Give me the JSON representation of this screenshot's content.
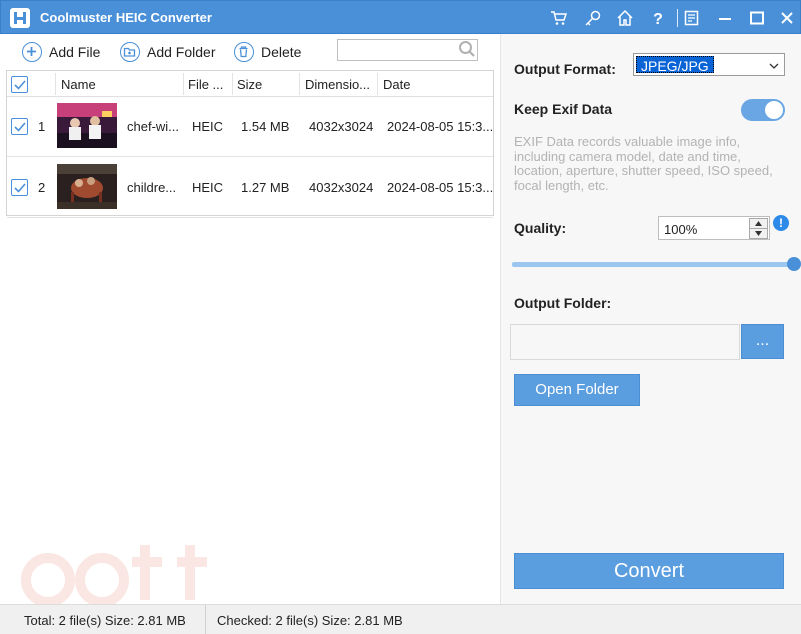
{
  "app": {
    "title": "Coolmuster HEIC Converter"
  },
  "titlebar_icons": [
    "cart-icon",
    "key-icon",
    "home-icon",
    "help-icon",
    "feedback-icon",
    "minimize-icon",
    "maximize-icon",
    "close-icon"
  ],
  "toolbar": {
    "add_file": "Add File",
    "add_folder": "Add Folder",
    "delete": "Delete",
    "search_value": ""
  },
  "table": {
    "headers": [
      "Name",
      "File ...",
      "Size",
      "Dimensio...",
      "Date"
    ],
    "rows": [
      {
        "index": "1",
        "name": "chef-wi...",
        "type": "HEIC",
        "size": "1.54 MB",
        "dimension": "4032x3024",
        "date": "2024-08-05 15:3...",
        "checked": true
      },
      {
        "index": "2",
        "name": "childre...",
        "type": "HEIC",
        "size": "1.27 MB",
        "dimension": "4032x3024",
        "date": "2024-08-05 15:3...",
        "checked": true
      }
    ]
  },
  "settings": {
    "output_format_label": "Output Format:",
    "output_format_value": "JPEG/JPG",
    "keep_exif_label": "Keep Exif Data",
    "keep_exif_on": true,
    "exif_description": "EXIF Data records valuable image info, including camera model, date and time, location, aperture, shutter speed, ISO speed, focal length, etc.",
    "quality_label": "Quality:",
    "quality_value": "100%",
    "quality_level": 1.0,
    "output_folder_label": "Output Folder:",
    "output_folder_value": "",
    "browse_label": "...",
    "open_folder_label": "Open Folder",
    "convert_label": "Convert"
  },
  "status": {
    "total": "Total: 2 file(s) Size: 2.81 MB",
    "checked": "Checked: 2 file(s) Size: 2.81 MB"
  },
  "colors": {
    "accent": "#4a90d9",
    "button": "#5b9ee0"
  }
}
